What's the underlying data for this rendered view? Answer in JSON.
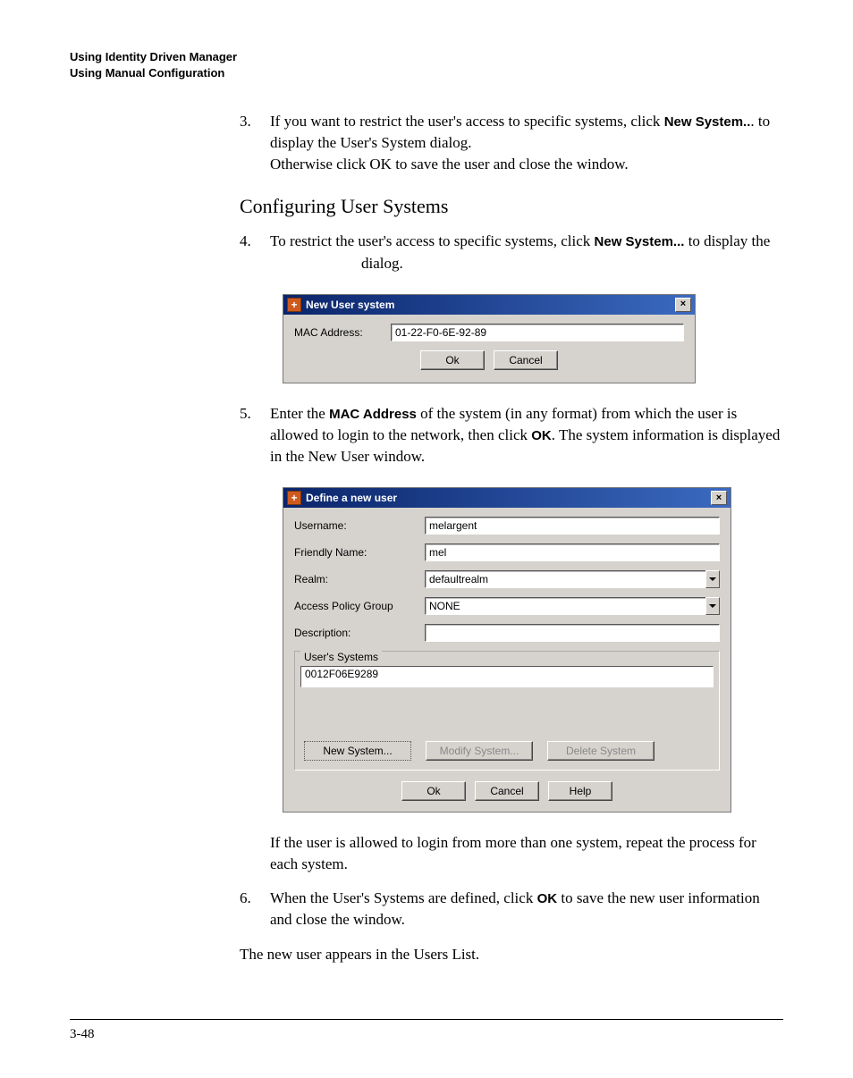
{
  "header": {
    "line1": "Using Identity Driven Manager",
    "line2": "Using Manual Configuration"
  },
  "step3": {
    "num": "3.",
    "t1": "If you want to restrict the user's access to specific systems, click ",
    "b1": "New System..",
    "t2": ". to display the User's System dialog.",
    "t3": "Otherwise click OK to save the user and close the window."
  },
  "section_title": "Configuring User Systems",
  "step4": {
    "num": "4.",
    "t1": "To restrict the user's access to specific systems, click ",
    "b1": "New System...",
    "t2": " to display the ",
    "t3": " dialog."
  },
  "dialog1": {
    "title": "New User system",
    "close": "×",
    "mac_label": "MAC Address:",
    "mac_value": "01-22-F0-6E-92-89",
    "ok": "Ok",
    "cancel": "Cancel"
  },
  "step5": {
    "num": "5.",
    "t1": "Enter the ",
    "b1": "MAC Address",
    "t2": " of the system (in any format) from which the user is allowed to login to the network, then click ",
    "b2": "OK",
    "t3": ". The system information is displayed in the New User window."
  },
  "dialog2": {
    "title": "Define a new user",
    "close": "×",
    "username_label": "Username:",
    "username_value": "melargent",
    "friendly_label": "Friendly Name:",
    "friendly_value": "mel",
    "realm_label": "Realm:",
    "realm_value": "defaultrealm",
    "apg_label": "Access Policy Group",
    "apg_value": "NONE",
    "desc_label": "Description:",
    "desc_value": "",
    "systems_label": "User's Systems",
    "systems_item": "0012F06E9289",
    "new_system": "New System...",
    "modify_system": "Modify System...",
    "delete_system": "Delete System",
    "ok": "Ok",
    "cancel": "Cancel",
    "help": "Help"
  },
  "after5": "If the user is allowed to login from more than one system, repeat the process for each system.",
  "step6": {
    "num": "6.",
    "t1": "When the User's Systems are defined, click ",
    "b1": "OK",
    "t2": " to save the new user information and close the window."
  },
  "closing": "The new user appears in the Users List.",
  "page_num": "3-48"
}
